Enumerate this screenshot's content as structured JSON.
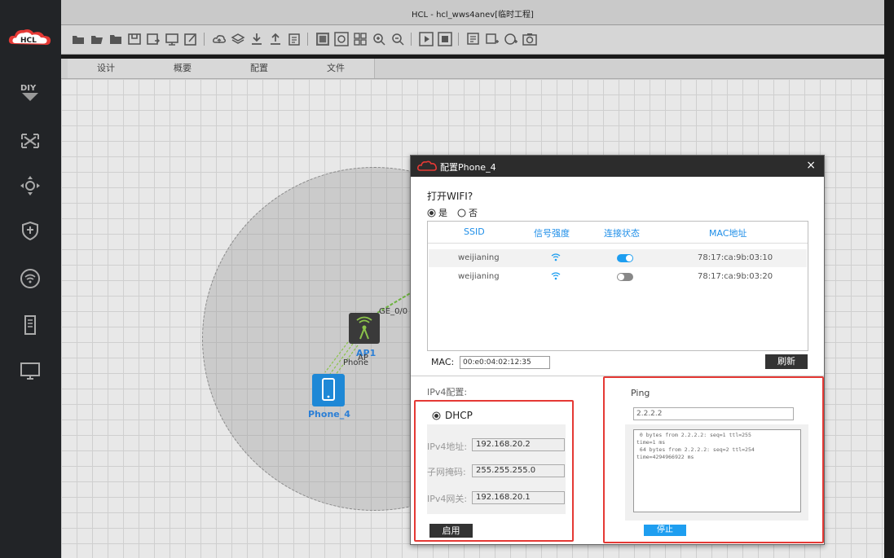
{
  "window": {
    "title": "HCL - hcl_wws4anev[临时工程]",
    "logo_text": "HCL"
  },
  "tabs": [
    "设计",
    "概要",
    "配置",
    "文件"
  ],
  "sidebar": {
    "items": [
      "diy-icon",
      "topology-icon",
      "move-icon",
      "shield-icon",
      "wifi-icon",
      "server-icon",
      "monitor-icon"
    ],
    "diy_label": "DIY"
  },
  "canvas": {
    "ap": {
      "name": "AP1",
      "sub": "AP",
      "port": "GE_0/0"
    },
    "phone": {
      "name": "Phone_4",
      "link_label": "Phone"
    }
  },
  "dialog": {
    "title": "配置Phone_4",
    "close": "×",
    "wifi_question": "打开WIFI?",
    "yes": "是",
    "no": "否",
    "columns": [
      "SSID",
      "信号强度",
      "连接状态",
      "MAC地址"
    ],
    "rows": [
      {
        "ssid": "weijianing",
        "mac": "78:17:ca:9b:03:10",
        "connected": true
      },
      {
        "ssid": "weijianing",
        "mac": "78:17:ca:9b:03:20",
        "connected": false
      }
    ],
    "mac_label": "MAC:",
    "mac_value": "00:e0:04:02:12:35",
    "refresh": "刷新",
    "ipv4_title": "IPv4配置:",
    "dhcp": "DHCP",
    "ipv4_addr_label": "IPv4地址:",
    "ipv4_addr": "192.168.20.2",
    "mask_label": "子网掩码:",
    "mask": "255.255.255.0",
    "gateway_label": "IPv4网关:",
    "gateway": "192.168.20.1",
    "enable": "启用",
    "ping_title": "Ping",
    "ping_target": "2.2.2.2",
    "ping_output": " 0 bytes from 2.2.2.2: seq=1 ttl=255\ntime=1 ms\n 64 bytes from 2.2.2.2: seq=2 ttl=254\ntime=4294966922 ms",
    "stop": "停止"
  },
  "colors": {
    "accent": "#1e8ee8",
    "highlight": "#e53935",
    "dark": "#2c2c2c"
  }
}
